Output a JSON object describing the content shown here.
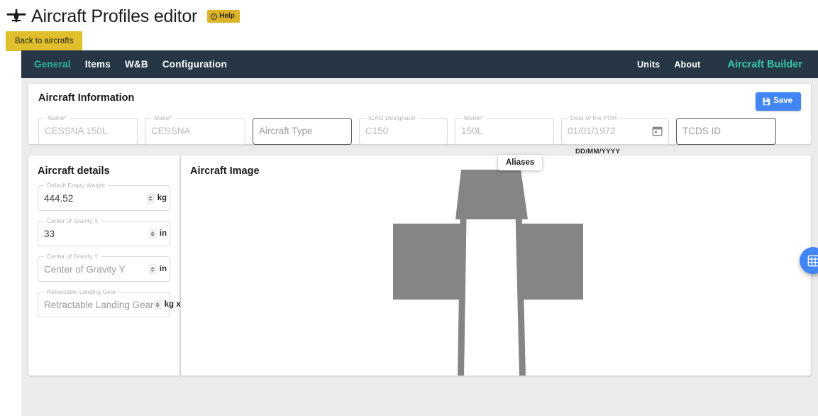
{
  "header": {
    "plane_icon": "airplane-front-icon",
    "title": "Aircraft Profiles editor",
    "help_label": "Help",
    "back_label": "Back to aircrafts"
  },
  "nav": {
    "left_items": [
      {
        "label": "General",
        "active": true
      },
      {
        "label": "Items",
        "active": false
      },
      {
        "label": "W&B",
        "active": false
      },
      {
        "label": "Configuration",
        "active": false
      }
    ],
    "right_items": [
      {
        "label": "Units"
      },
      {
        "label": "About"
      }
    ],
    "brand": "Aircraft Builder"
  },
  "info": {
    "title": "Aircraft Information",
    "save_label": "Save",
    "save_icon": "floppy-disk-icon",
    "tooltip": "Aliases",
    "date_hint": "DD/MM/YYYY",
    "fields": [
      {
        "legend": "Name*",
        "value": "CESSNA 150L",
        "state": "placeholder"
      },
      {
        "legend": "Make*",
        "value": "CESSNA",
        "state": "placeholder"
      },
      {
        "legend": "",
        "value": "Aircraft Type",
        "state": "focused-placeholder"
      },
      {
        "legend": "ICAO Designator",
        "value": "C150",
        "state": "placeholder"
      },
      {
        "legend": "Model*",
        "value": "150L",
        "state": "placeholder"
      },
      {
        "legend": "Date of the POH",
        "value": "01/01/1972",
        "state": "placeholder"
      },
      {
        "legend": "",
        "value": "TCDS ID",
        "state": "focused-placeholder"
      }
    ]
  },
  "details": {
    "title": "Aircraft details",
    "fields": [
      {
        "legend": "Default Empty Weight",
        "value": "444.52",
        "unit": "kg",
        "filled": true
      },
      {
        "legend": "Center of Gravity X",
        "value": "33",
        "unit": "in",
        "filled": true
      },
      {
        "legend": "Center of Gravity Y",
        "value": "Center of Gravity Y",
        "unit": "in",
        "filled": false
      },
      {
        "legend": "Retractable Landing Gear",
        "value": "Retractable Landing Gear",
        "unit": "kg x in",
        "filled": false
      }
    ]
  },
  "image_panel": {
    "title": "Aircraft Image",
    "diagram_name": "aircraft-top-view-diagram",
    "diagram_color": "#858585",
    "fab_icon": "grid-table-icon"
  },
  "colors": {
    "accent_yellow": "#dfc02c",
    "nav_dark": "#263645",
    "brand_green": "#32c9a5",
    "primary_blue": "#4285f4",
    "shell_gray": "#ececec"
  }
}
